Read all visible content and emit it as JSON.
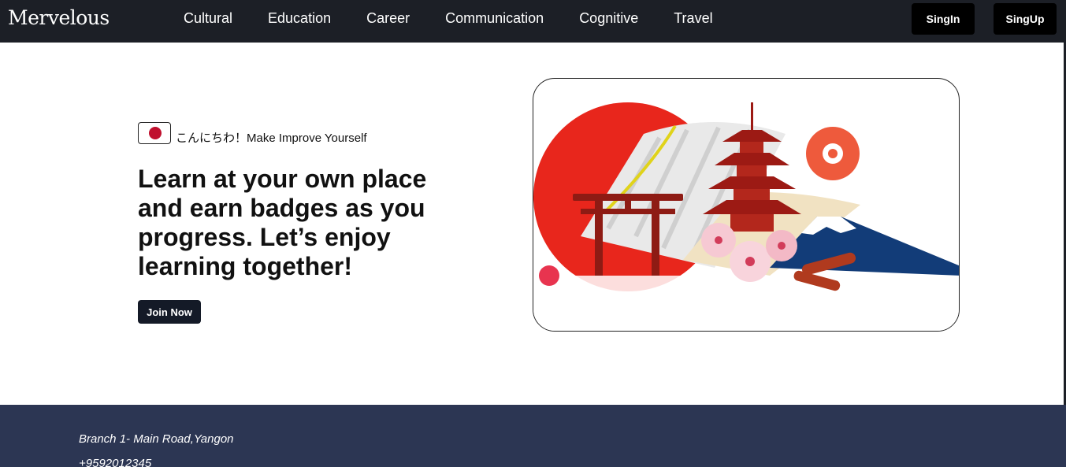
{
  "navbar": {
    "brand": "Mervelous",
    "links": [
      "Cultural",
      "Education",
      "Career",
      "Communication",
      "Cognitive",
      "Travel"
    ],
    "signin_label": "SingIn",
    "signup_label": "SingUp"
  },
  "hero": {
    "greeting": "こんにちわ！Make Improve Yourself",
    "headline": "Learn at your own place and earn badges as you progress. Let’s enjoy learning together!",
    "join_label": "Join Now",
    "flag_icon": "japan-flag-icon",
    "colors": {
      "sun": "#e8261c",
      "pagoda": "#9c1a14",
      "mountain": "#123c78",
      "button": "#141a27"
    }
  },
  "footer": {
    "address": "Branch 1- Main Road,Yangon",
    "phone": "+9592012345"
  }
}
